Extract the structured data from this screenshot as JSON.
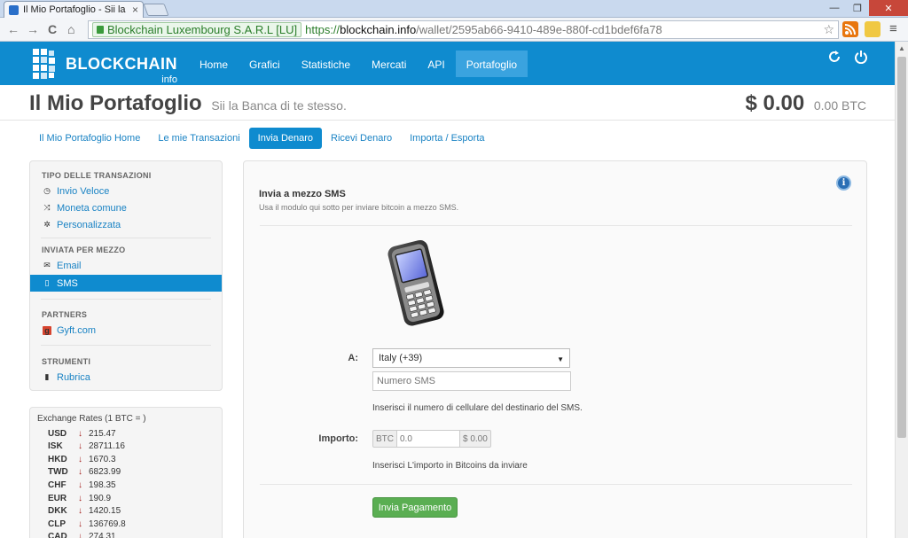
{
  "browser": {
    "tab_title": "Il Mio Portafoglio - Sii la B",
    "tab_close": "×",
    "window_controls": {
      "minimize": "—",
      "maximize": "❐",
      "close": "✕"
    },
    "nav": {
      "back": "←",
      "forward": "→",
      "reload": "C",
      "home": "⌂"
    },
    "ev_name": "Blockchain Luxembourg S.A.R.L [LU]",
    "url_scheme": "https://",
    "url_host": "blockchain.info",
    "url_path": "/wallet/2595ab66-9410-489e-880f-cd1bdef6fa78",
    "bookmark_star": "☆",
    "menu_icon": "≡"
  },
  "site": {
    "logo_text": "BLOCKCHAIN",
    "logo_sub": "info",
    "menu": [
      "Home",
      "Grafici",
      "Statistiche",
      "Mercati",
      "API",
      "Portafoglio"
    ],
    "active_menu": "Portafoglio"
  },
  "header": {
    "title": "Il Mio Portafoglio",
    "subtitle": "Sii la Banca di te stesso.",
    "balance_fiat": "$ 0.00",
    "balance_btc": "0.00 BTC"
  },
  "subtabs": [
    "Il Mio Portafoglio Home",
    "Le mie Transazioni",
    "Invia Denaro",
    "Ricevi Denaro",
    "Importa / Esporta"
  ],
  "sidebar": {
    "section_type": "TIPO DELLE TRANSAZIONI",
    "type_items": [
      "Invio Veloce",
      "Moneta comune",
      "Personalizzata"
    ],
    "section_via": "INVIATA PER MEZZO",
    "via_items": [
      "Email",
      "SMS"
    ],
    "section_partners": "PARTNERS",
    "partner_items": [
      "Gyft.com"
    ],
    "section_tools": "STRUMENTI",
    "tool_items": [
      "Rubrica"
    ]
  },
  "exchange": {
    "title": "Exchange Rates (1 BTC = )",
    "rates": [
      {
        "cur": "USD",
        "val": "215.47"
      },
      {
        "cur": "ISK",
        "val": "28711.16"
      },
      {
        "cur": "HKD",
        "val": "1670.3"
      },
      {
        "cur": "TWD",
        "val": "6823.99"
      },
      {
        "cur": "CHF",
        "val": "198.35"
      },
      {
        "cur": "EUR",
        "val": "190.9"
      },
      {
        "cur": "DKK",
        "val": "1420.15"
      },
      {
        "cur": "CLP",
        "val": "136769.8"
      },
      {
        "cur": "CAD",
        "val": "274.31"
      }
    ]
  },
  "panel": {
    "title": "Invia a mezzo SMS",
    "description": "Usa il modulo qui sotto per inviare bitcoin a mezzo SMS.",
    "to_label": "A:",
    "country_selected": "Italy (+39)",
    "sms_placeholder": "Numero SMS",
    "sms_help": "Inserisci il numero di cellulare del destinario del SMS.",
    "amount_label": "Importo:",
    "btc_addon": "BTC",
    "amount_placeholder": "0.0",
    "fiat_addon": "$ 0.00",
    "amount_help": "Inserisci L'importo in Bitcoins da inviare",
    "pay_button": "Invia Pagamento",
    "info_icon_glyph": "i"
  },
  "colors": {
    "brand_blue": "#0f8bcf",
    "menu_active": "#3aa3df",
    "link": "#1a83c4",
    "pay_green": "#5aae52",
    "rate_down": "#a3201c"
  }
}
